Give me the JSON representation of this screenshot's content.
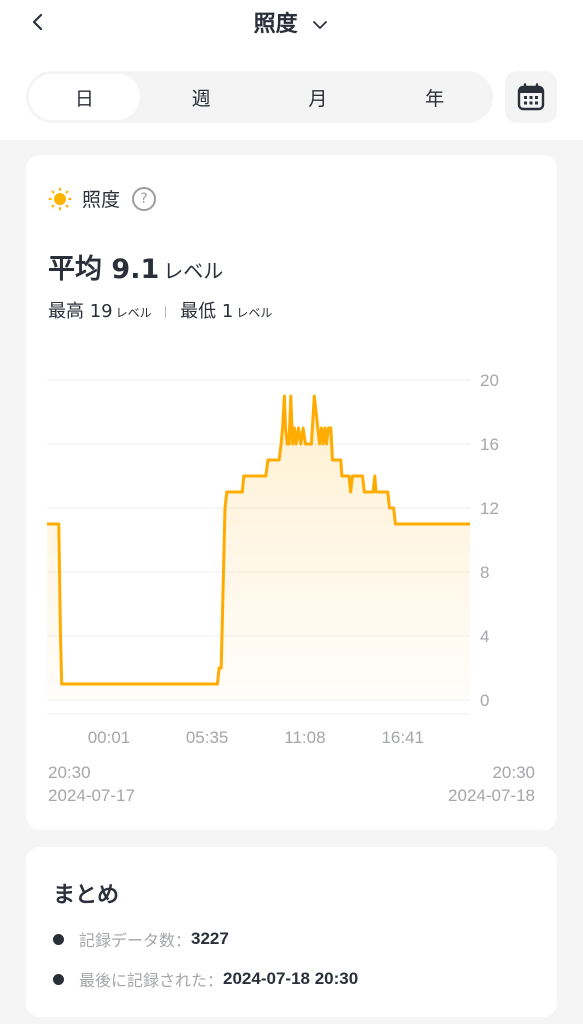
{
  "header": {
    "title": "照度",
    "back_icon": "chevron-left-icon",
    "dropdown_icon": "chevron-down-icon"
  },
  "period_tabs": [
    {
      "label": "日",
      "active": true
    },
    {
      "label": "週",
      "active": false
    },
    {
      "label": "月",
      "active": false
    },
    {
      "label": "年",
      "active": false
    }
  ],
  "calendar_icon": "calendar-icon",
  "metric": {
    "icon": "sun-icon",
    "name": "照度",
    "help_icon": "?",
    "avg_prefix": "平均",
    "avg_value": "9.1",
    "unit": "レベル",
    "max_label": "最高",
    "max_value": "19",
    "min_label": "最低",
    "min_value": "1"
  },
  "colors": {
    "accent": "#ffab00",
    "fill": "#fff3dc",
    "grid": "#efefef",
    "text": "#2b2f3a",
    "muted": "#a4a6ab"
  },
  "chart_data": {
    "type": "area",
    "title": "照度",
    "xlabel": "",
    "ylabel": "レベル",
    "ylim": [
      0,
      20
    ],
    "yticks": [
      0,
      4,
      8,
      12,
      16,
      20
    ],
    "xlim_minutes": [
      0,
      1440
    ],
    "xtick_labels": [
      {
        "label": "00:01",
        "minute": 211
      },
      {
        "label": "05:35",
        "minute": 545
      },
      {
        "label": "11:08",
        "minute": 878
      },
      {
        "label": "16:41",
        "minute": 1211
      }
    ],
    "start": {
      "time": "20:30",
      "date": "2024-07-17"
    },
    "end": {
      "time": "20:30",
      "date": "2024-07-18"
    },
    "grid": true,
    "series": [
      {
        "name": "照度",
        "points": [
          [
            0,
            11
          ],
          [
            40,
            11
          ],
          [
            46,
            4
          ],
          [
            50,
            1
          ],
          [
            580,
            1
          ],
          [
            586,
            2
          ],
          [
            593,
            2
          ],
          [
            606,
            12
          ],
          [
            612,
            13
          ],
          [
            665,
            13
          ],
          [
            670,
            14
          ],
          [
            745,
            14
          ],
          [
            752,
            15
          ],
          [
            790,
            15
          ],
          [
            797,
            16
          ],
          [
            802,
            17
          ],
          [
            808,
            19
          ],
          [
            812,
            17
          ],
          [
            818,
            16
          ],
          [
            824,
            16
          ],
          [
            830,
            19
          ],
          [
            836,
            16
          ],
          [
            842,
            17
          ],
          [
            848,
            16
          ],
          [
            856,
            17
          ],
          [
            864,
            16
          ],
          [
            872,
            17
          ],
          [
            880,
            16
          ],
          [
            900,
            16
          ],
          [
            910,
            19
          ],
          [
            916,
            18
          ],
          [
            922,
            17
          ],
          [
            928,
            16
          ],
          [
            934,
            17
          ],
          [
            940,
            16
          ],
          [
            946,
            17
          ],
          [
            952,
            16
          ],
          [
            958,
            17
          ],
          [
            966,
            17
          ],
          [
            972,
            15
          ],
          [
            1000,
            15
          ],
          [
            1004,
            14
          ],
          [
            1028,
            14
          ],
          [
            1034,
            13
          ],
          [
            1040,
            14
          ],
          [
            1074,
            14
          ],
          [
            1080,
            13
          ],
          [
            1110,
            13
          ],
          [
            1116,
            14
          ],
          [
            1120,
            13
          ],
          [
            1160,
            13
          ],
          [
            1166,
            12
          ],
          [
            1180,
            12
          ],
          [
            1186,
            11
          ],
          [
            1440,
            11
          ]
        ]
      }
    ]
  },
  "summary": {
    "title": "まとめ",
    "items": [
      {
        "label": "記録データ数：",
        "value": "3227"
      },
      {
        "label": "最後に記録された：",
        "value": "2024-07-18 20:30"
      }
    ]
  }
}
